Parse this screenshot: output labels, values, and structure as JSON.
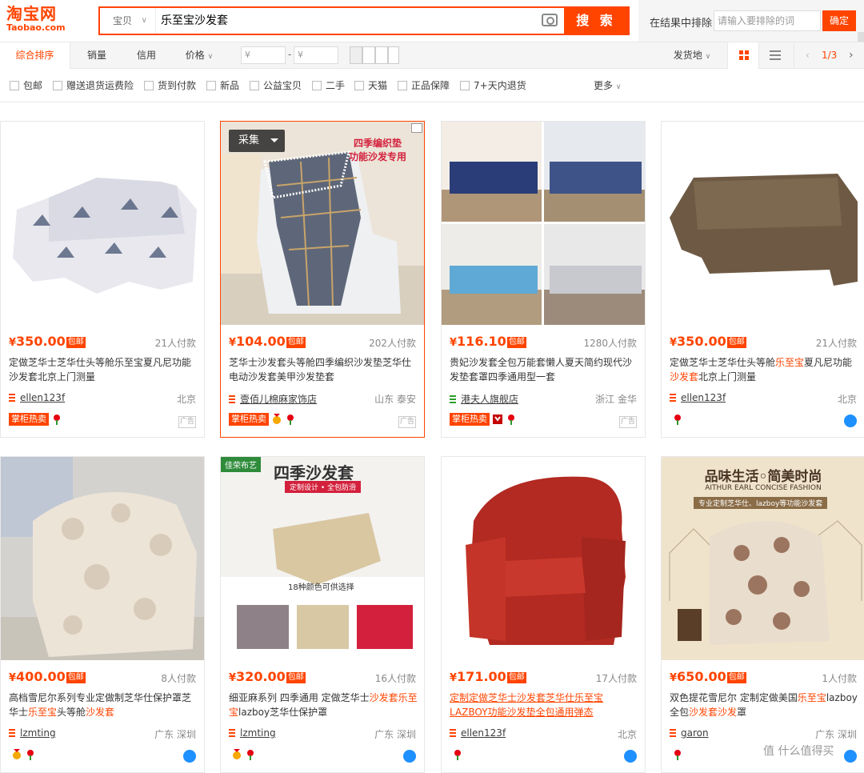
{
  "logo": {
    "cn": "淘宝网",
    "en": "Taobao.com"
  },
  "search": {
    "type": "宝贝",
    "query": "乐至宝沙发套",
    "button": "搜 索"
  },
  "exclude": {
    "label": "在结果中排除",
    "placeholder": "请输入要排除的词",
    "confirm": "确定"
  },
  "sort": {
    "tabs": [
      "综合排序",
      "销量",
      "信用",
      "价格"
    ],
    "price_min_placeholder": "¥",
    "price_max_placeholder": "¥",
    "dash": "-",
    "ship_from": "发货地",
    "page": "1/3"
  },
  "filters": [
    "包邮",
    "赠送退货运费险",
    "货到付款",
    "新品",
    "公益宝贝",
    "二手",
    "天猫",
    "正品保障",
    "7+天内退货"
  ],
  "more": "更多",
  "caiji": "采集",
  "ad_label": "广告",
  "zg_label": "掌柜热卖",
  "products": [
    {
      "price": "350.00",
      "baoyou": "包邮",
      "paid": "21人付款",
      "title_parts": [
        {
          "t": "定做芝华士芝华仕头等舱乐至宝夏凡尼功能沙发套北京上门测量",
          "h": false
        }
      ],
      "shop": "ellen123f",
      "loc": "北京"
    },
    {
      "price": "104.00",
      "baoyou": "包邮",
      "paid": "202人付款",
      "title_parts": [
        {
          "t": "芝华士沙发套头等舱四季编织沙发垫芝华仕电动沙发套美甲沙发垫套",
          "h": false
        }
      ],
      "shop": "壹佰儿棉麻家饰店",
      "loc": "山东 泰安",
      "img_text": [
        "四季编织垫",
        "功能沙发专用"
      ]
    },
    {
      "price": "116.10",
      "baoyou": "包邮",
      "paid": "1280人付款",
      "title_parts": [
        {
          "t": "贵妃沙发套全包万能套懒人夏天简约现代沙发垫套罩四季通用型一套",
          "h": false
        }
      ],
      "shop": "港夫人旗舰店",
      "loc": "浙江 金华"
    },
    {
      "price": "350.00",
      "baoyou": "包邮",
      "paid": "21人付款",
      "title_parts": [
        {
          "t": "定做芝华士芝华仕头等舱",
          "h": false
        },
        {
          "t": "乐至宝",
          "h": true
        },
        {
          "t": "夏凡尼功能",
          "h": false
        },
        {
          "t": "沙发套",
          "h": true
        },
        {
          "t": "北京上门测量",
          "h": false
        }
      ],
      "shop": "ellen123f",
      "loc": "北京"
    },
    {
      "price": "400.00",
      "baoyou": "包邮",
      "paid": "8人付款",
      "title_parts": [
        {
          "t": "高档雪尼尔系列专业定做制芝华仕保护罩芝华士",
          "h": false
        },
        {
          "t": "乐至宝",
          "h": true
        },
        {
          "t": "头等舱",
          "h": false
        },
        {
          "t": "沙发套",
          "h": true
        }
      ],
      "shop": "lzmting",
      "loc": "广东 深圳"
    },
    {
      "price": "320.00",
      "baoyou": "包邮",
      "paid": "16人付款",
      "title_parts": [
        {
          "t": "细亚麻系列 四季通用 定做芝华士",
          "h": false
        },
        {
          "t": "沙发套乐至宝",
          "h": true
        },
        {
          "t": "lazboy芝华仕保护罩",
          "h": false
        }
      ],
      "shop": "lzmting",
      "loc": "广东 深圳",
      "img_text": [
        "佳荣布艺",
        "四季沙发套",
        "定制设计 • 全包防滑",
        "18种颜色可供选择"
      ]
    },
    {
      "price": "171.00",
      "baoyou": "包邮",
      "paid": "17人付款",
      "title_parts": [
        {
          "t": "定制定做芝华士沙发套芝华仕乐至宝LAZBOY功能沙发垫全包通用弹态",
          "h": false
        }
      ],
      "shop": "ellen123f",
      "loc": "北京"
    },
    {
      "price": "650.00",
      "baoyou": "包邮",
      "paid": "1人付款",
      "title_parts": [
        {
          "t": "双色提花雪尼尔 定制定做美国",
          "h": false
        },
        {
          "t": "乐至宝",
          "h": true
        },
        {
          "t": "lazboy全包",
          "h": false
        },
        {
          "t": "沙发套沙发",
          "h": true
        },
        {
          "t": "罩",
          "h": false
        }
      ],
      "shop": "garon",
      "loc": "广东 深圳",
      "img_text": [
        "品味生活◦简美时尚",
        "AITHUR EARL CONCISE FASHION",
        "专业定制芝华仕、lazboy等功能沙发套"
      ]
    }
  ],
  "watermark": "值 什么值得买",
  "colors": {
    "accent": "#ff4400",
    "bg": "#f5f5f5"
  }
}
